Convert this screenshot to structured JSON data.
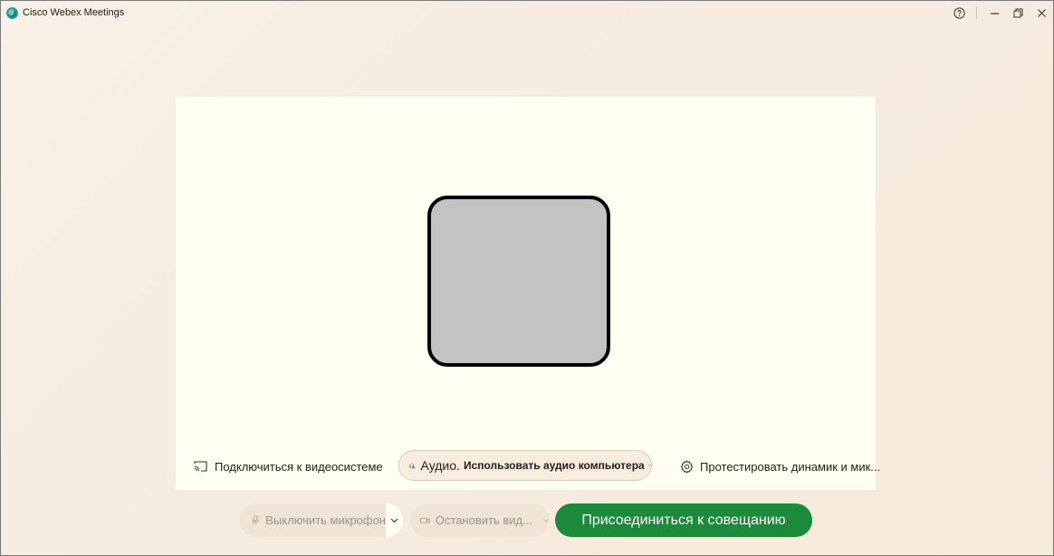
{
  "window": {
    "title": "Cisco Webex Meetings"
  },
  "preview": {
    "connect_video_label": "Подключиться к видеосистеме",
    "audio": {
      "label": "Аудио.",
      "value": "Использовать аудио компьютера"
    },
    "test_speaker_label": "Протестировать динамик и мик..."
  },
  "controls": {
    "mute_label": "Выключить микрофон",
    "video_label": "Остановить вид...",
    "join_label": "Присоединиться к совещанию"
  },
  "colors": {
    "join_button": "#1c8a3b",
    "preview_background": "#fefff0",
    "avatar_fill": "#c3c3c3",
    "window_background": "#f7eee3"
  },
  "icons": {
    "app": "webex-logo-icon",
    "help": "help-icon",
    "minimize": "minimize-icon",
    "restore": "restore-icon",
    "close": "close-icon",
    "cast": "cast-icon",
    "headset": "headset-icon",
    "settings": "gear-icon",
    "microphone": "microphone-muted-icon",
    "camera": "camera-icon"
  }
}
